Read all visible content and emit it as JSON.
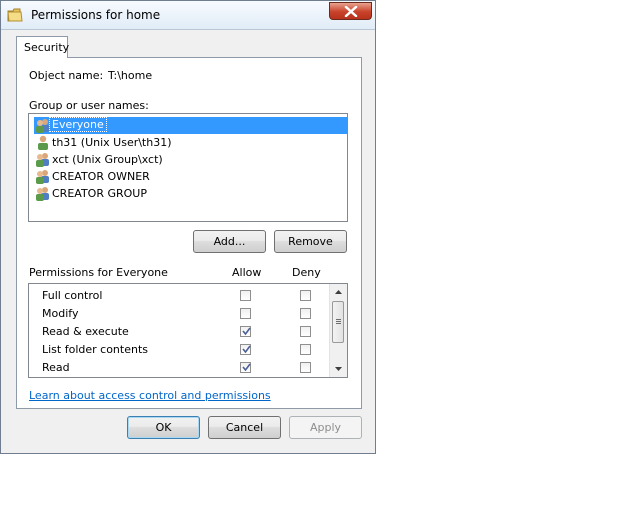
{
  "window": {
    "title": "Permissions for home"
  },
  "tabs": [
    {
      "label": "Security"
    }
  ],
  "object": {
    "label": "Object name:",
    "value": "T:\\home"
  },
  "group": {
    "label": "Group or user names:",
    "items": [
      {
        "label": "Everyone",
        "selected": true,
        "icon": "users-icon"
      },
      {
        "label": "th31 (Unix User\\th31)",
        "selected": false,
        "icon": "user-icon"
      },
      {
        "label": "xct (Unix Group\\xct)",
        "selected": false,
        "icon": "users-icon"
      },
      {
        "label": "CREATOR OWNER",
        "selected": false,
        "icon": "users-icon"
      },
      {
        "label": "CREATOR GROUP",
        "selected": false,
        "icon": "users-icon"
      }
    ]
  },
  "buttons": {
    "add": "Add...",
    "remove": "Remove",
    "ok": "OK",
    "cancel": "Cancel",
    "apply": "Apply"
  },
  "permissions": {
    "label": "Permissions for Everyone",
    "allow_header": "Allow",
    "deny_header": "Deny",
    "rows": [
      {
        "name": "Full control",
        "allow": false,
        "deny": false
      },
      {
        "name": "Modify",
        "allow": false,
        "deny": false
      },
      {
        "name": "Read & execute",
        "allow": true,
        "deny": false
      },
      {
        "name": "List folder contents",
        "allow": true,
        "deny": false
      },
      {
        "name": "Read",
        "allow": true,
        "deny": false
      }
    ]
  },
  "link": {
    "text": "Learn about access control and permissions"
  },
  "colors": {
    "selection": "#3399ff",
    "link": "#0066cc",
    "close": "#c9422a"
  }
}
